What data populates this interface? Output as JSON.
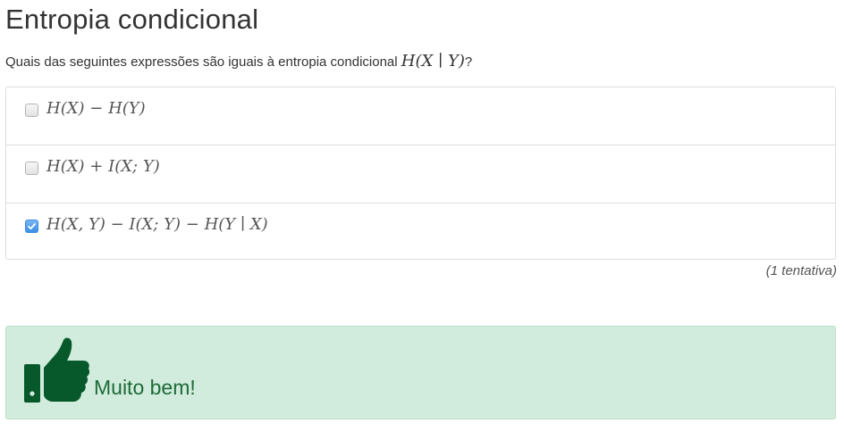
{
  "page": {
    "title": "Entropia condicional"
  },
  "question": {
    "text": "Quais das seguintes expressões são iguais à entropia condicional ",
    "math": "H(X ∣ Y)",
    "suffix": "?"
  },
  "options": [
    {
      "math": "H(X) − H(Y)",
      "checked": false
    },
    {
      "math": "H(X) + I(X; Y)",
      "checked": false
    },
    {
      "math": "H(X, Y) − I(X; Y) − H(Y ∣ X)",
      "checked": true
    }
  ],
  "attempts": {
    "text": "(1 tentativa)"
  },
  "feedback": {
    "icon": "thumbs-up-icon",
    "text": "Muito bem!",
    "color": "#1e6b39",
    "background": "#d1ecdc",
    "icon_color": "#07582b"
  }
}
